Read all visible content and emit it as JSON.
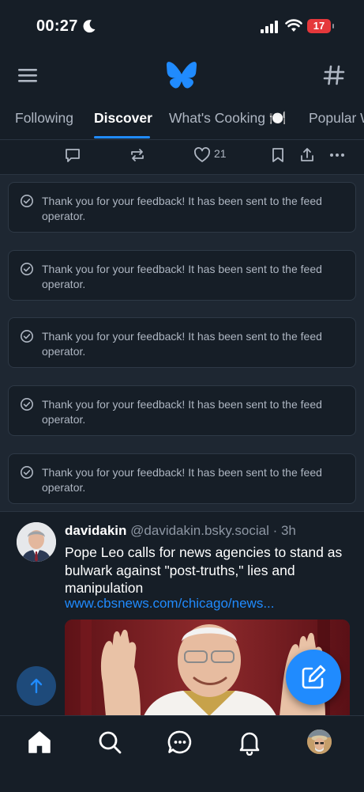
{
  "status_bar": {
    "time": "00:27",
    "battery": "17"
  },
  "tabs": [
    {
      "label": "Following"
    },
    {
      "label": "Discover"
    },
    {
      "label": "What's Cooking 🍽️"
    },
    {
      "label": "Popular W"
    }
  ],
  "active_tab": "Discover",
  "post_actions": {
    "like_count": "21"
  },
  "feedback_cards": [
    {
      "text": "Thank you for your feedback! It has been sent to the feed operator."
    },
    {
      "text": "Thank you for your feedback! It has been sent to the feed operator."
    },
    {
      "text": "Thank you for your feedback! It has been sent to the feed operator."
    },
    {
      "text": "Thank you for your feedback! It has been sent to the feed operator."
    },
    {
      "text": "Thank you for your feedback! It has been sent to the feed operator."
    }
  ],
  "post": {
    "author": "davidakin",
    "handle": "@davidakin.bsky.social",
    "time": "· 3h",
    "text": "Pope Leo calls for news agencies to stand as bulwark against \"post-truths,\" lies and manipulation",
    "link": "www.cbsnews.com/chicago/news..."
  },
  "colors": {
    "background": "#161e27",
    "accent": "#208bfe",
    "battery_low": "#e5383b",
    "muted_text": "#aeb6c2"
  },
  "icons": {
    "top_left": "hamburger-menu-icon",
    "logo": "butterfly-logo-icon",
    "top_right": "hashtag-icon",
    "post_actions": [
      "comment-icon",
      "repost-icon",
      "heart-icon",
      "bookmark-icon",
      "share-icon",
      "more-icon"
    ],
    "feedback": "check-circle-icon",
    "bottom_nav": [
      "home-icon",
      "search-icon",
      "chat-icon",
      "bell-icon",
      "profile-avatar"
    ]
  }
}
